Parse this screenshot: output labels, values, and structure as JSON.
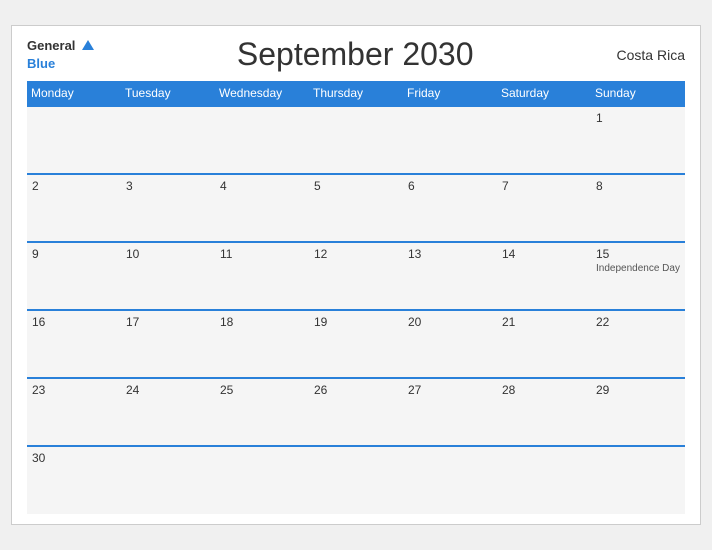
{
  "header": {
    "title": "September 2030",
    "country": "Costa Rica",
    "logo_general": "General",
    "logo_blue": "Blue"
  },
  "weekdays": [
    "Monday",
    "Tuesday",
    "Wednesday",
    "Thursday",
    "Friday",
    "Saturday",
    "Sunday"
  ],
  "weeks": [
    [
      {
        "day": "",
        "event": ""
      },
      {
        "day": "",
        "event": ""
      },
      {
        "day": "",
        "event": ""
      },
      {
        "day": "",
        "event": ""
      },
      {
        "day": "",
        "event": ""
      },
      {
        "day": "",
        "event": ""
      },
      {
        "day": "1",
        "event": ""
      }
    ],
    [
      {
        "day": "2",
        "event": ""
      },
      {
        "day": "3",
        "event": ""
      },
      {
        "day": "4",
        "event": ""
      },
      {
        "day": "5",
        "event": ""
      },
      {
        "day": "6",
        "event": ""
      },
      {
        "day": "7",
        "event": ""
      },
      {
        "day": "8",
        "event": ""
      }
    ],
    [
      {
        "day": "9",
        "event": ""
      },
      {
        "day": "10",
        "event": ""
      },
      {
        "day": "11",
        "event": ""
      },
      {
        "day": "12",
        "event": ""
      },
      {
        "day": "13",
        "event": ""
      },
      {
        "day": "14",
        "event": ""
      },
      {
        "day": "15",
        "event": "Independence Day"
      }
    ],
    [
      {
        "day": "16",
        "event": ""
      },
      {
        "day": "17",
        "event": ""
      },
      {
        "day": "18",
        "event": ""
      },
      {
        "day": "19",
        "event": ""
      },
      {
        "day": "20",
        "event": ""
      },
      {
        "day": "21",
        "event": ""
      },
      {
        "day": "22",
        "event": ""
      }
    ],
    [
      {
        "day": "23",
        "event": ""
      },
      {
        "day": "24",
        "event": ""
      },
      {
        "day": "25",
        "event": ""
      },
      {
        "day": "26",
        "event": ""
      },
      {
        "day": "27",
        "event": ""
      },
      {
        "day": "28",
        "event": ""
      },
      {
        "day": "29",
        "event": ""
      }
    ],
    [
      {
        "day": "30",
        "event": ""
      },
      {
        "day": "",
        "event": ""
      },
      {
        "day": "",
        "event": ""
      },
      {
        "day": "",
        "event": ""
      },
      {
        "day": "",
        "event": ""
      },
      {
        "day": "",
        "event": ""
      },
      {
        "day": "",
        "event": ""
      }
    ]
  ]
}
